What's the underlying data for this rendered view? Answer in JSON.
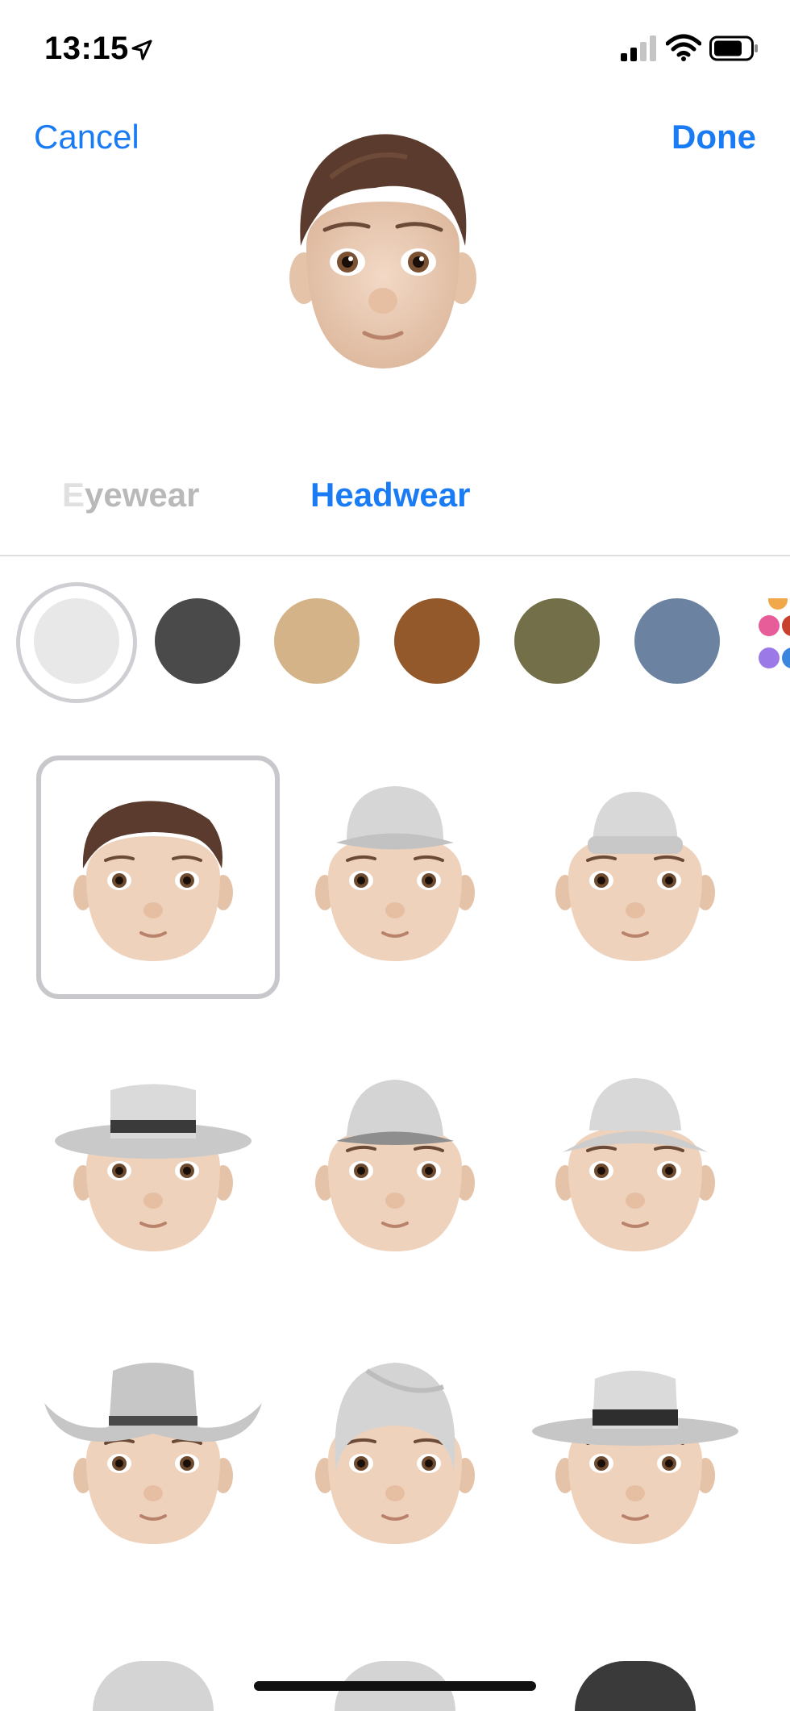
{
  "status_bar": {
    "time": "13:15"
  },
  "nav": {
    "cancel_label": "Cancel",
    "done_label": "Done"
  },
  "tabs": {
    "eyewear_fade": "E",
    "eyewear_rest": "yewear",
    "headwear": "Headwear"
  },
  "colors": {
    "accent": "#1a7cf4",
    "swatches": [
      "#e8e8e8",
      "#4a4a4a",
      "#d4b389",
      "#93592a",
      "#737049",
      "#6b83a1"
    ],
    "selected_swatch_index": 0
  },
  "headwear_options": [
    {
      "icon": "no-headwear-icon",
      "selected": true
    },
    {
      "icon": "flat-cap-icon",
      "selected": false
    },
    {
      "icon": "beanie-cap-icon",
      "selected": false
    },
    {
      "icon": "fedora-hat-icon",
      "selected": false
    },
    {
      "icon": "bucket-hat-icon",
      "selected": false
    },
    {
      "icon": "wide-bucket-hat-icon",
      "selected": false
    },
    {
      "icon": "cowboy-hat-icon",
      "selected": false
    },
    {
      "icon": "turban-icon",
      "selected": false
    },
    {
      "icon": "panama-hat-icon",
      "selected": false
    }
  ]
}
